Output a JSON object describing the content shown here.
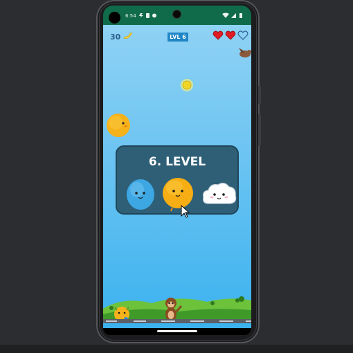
{
  "status_bar": {
    "time": "6:54"
  },
  "hud": {
    "score": "30",
    "level_badge": "LVL 6",
    "hearts_filled": 2,
    "hearts_total": 3
  },
  "dialog": {
    "title": "6. LEVEL",
    "characters": [
      "blue-ball-character",
      "yellow-chick-character",
      "white-cloud-character"
    ]
  },
  "colors": {
    "sky": "#6fc5f2",
    "dialog": "#2e5f77",
    "status_bar": "#0f6b4a",
    "heart": "#e01b24"
  }
}
